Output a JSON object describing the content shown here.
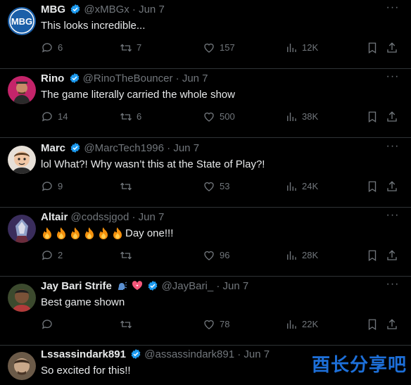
{
  "replies": [
    {
      "name": "MBG",
      "handle": "@xMBGx",
      "separator": "·",
      "date": "Jun 7",
      "text": "This looks incredible...",
      "replies": "6",
      "reposts": "7",
      "likes": "157",
      "views": "12K",
      "avatar_text": "MBG",
      "avatar_color": "#1b5fa8"
    },
    {
      "name": "Rino",
      "handle": "@RinoTheBouncer",
      "separator": "·",
      "date": "Jun 7",
      "text": "The game literally carried the whole show",
      "replies": "14",
      "reposts": "6",
      "likes": "500",
      "views": "38K",
      "avatar_color": "#c4246a"
    },
    {
      "name": "Marc",
      "handle": "@MarcTech1996",
      "separator": "·",
      "date": "Jun 7",
      "text": "lol What?! Why wasn’t this at the State of Play?!",
      "replies": "9",
      "reposts": "",
      "likes": "53",
      "views": "24K",
      "avatar_color": "#e7e0d8"
    },
    {
      "name": "Altair",
      "handle": "@codssjgod",
      "separator": "·",
      "date": "Jun 7",
      "text": "Day one!!!",
      "replies": "2",
      "reposts": "",
      "likes": "96",
      "views": "28K",
      "avatar_color": "#3a2d5c"
    },
    {
      "name": "Jay Bari Strife",
      "handle": "@JayBari_",
      "separator": "·",
      "date": "Jun 7",
      "text": "Best game shown",
      "replies": "",
      "reposts": "",
      "likes": "78",
      "views": "22K",
      "avatar_color": "#3c4a2e"
    },
    {
      "name": "Lssassindark891",
      "handle": "@assassindark891",
      "separator": "·",
      "date": "Jun 7",
      "text": "So excited for this!!",
      "avatar_color": "#6b5a48"
    }
  ],
  "watermark": "酉长分享吧",
  "colors": {
    "verified": "#1d9bf0",
    "muted": "#71767b",
    "text": "#e7e9ea",
    "divider": "#2f3336"
  }
}
